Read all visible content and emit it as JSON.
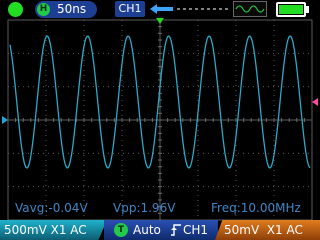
{
  "status": {
    "run_state": "running",
    "run_color": "#22dd22"
  },
  "timebase": {
    "badge": "H",
    "value": "50ns"
  },
  "trigger_source_box": "CH1",
  "battery": {
    "level_fraction": 1.0
  },
  "measurements": {
    "vavg": "Vavg:-0.04V",
    "vpp": "Vpp:1.96V",
    "freq": "Freq:10.00MHz"
  },
  "bottom": {
    "ch1": {
      "label": "500mV X1 AC",
      "color": "#1fb2cc"
    },
    "trigger": {
      "badge": "T",
      "mode": "Auto",
      "edge_icon": "rising-edge-icon",
      "source": "CH1"
    },
    "ch2": {
      "label": "50mV  X1 AC",
      "color": "#e27c1f"
    }
  },
  "colors": {
    "trace": "#2aa9c8",
    "grid": "#5a5a5a",
    "ch1_marker": "#1fa6d8",
    "ch2_marker": "#ff4aa0",
    "trigger_marker": "#22dd22",
    "meas_text": "#3f86c6"
  },
  "waveform": {
    "cycles_visible": 7,
    "frequency": "10.00MHz",
    "vpp": "1.96V"
  }
}
